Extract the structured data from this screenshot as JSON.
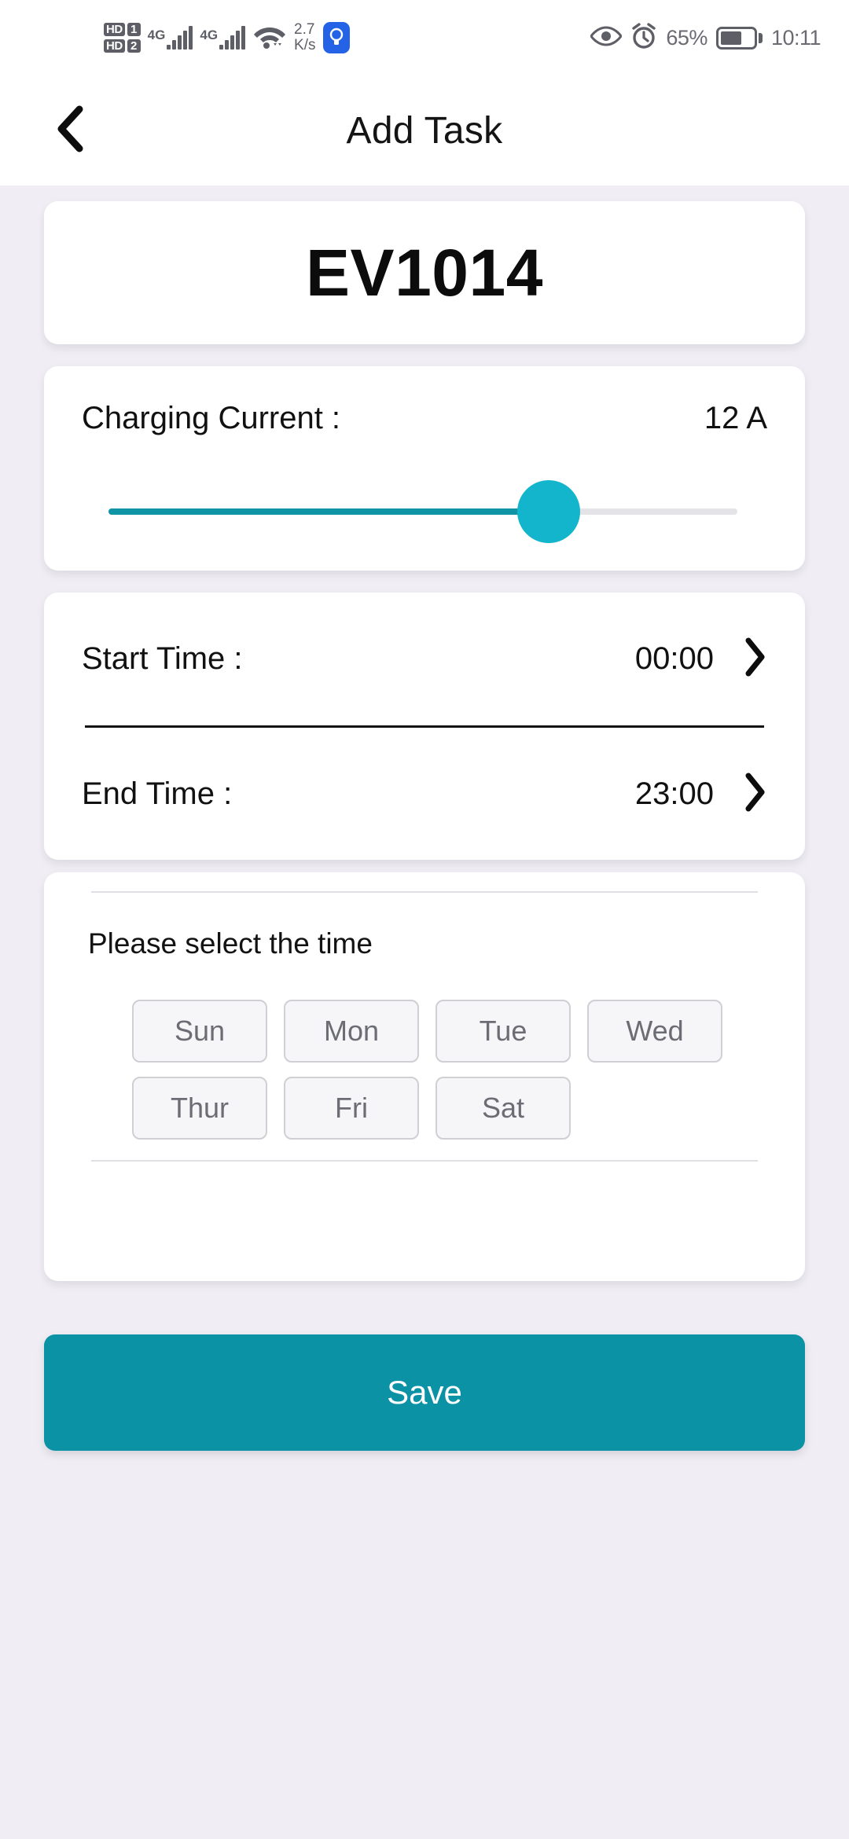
{
  "status_bar": {
    "hd1_label": "HD",
    "sim1_label": "1",
    "hd2_label": "HD",
    "sim2_label": "2",
    "network1": "4G",
    "network2": "4G",
    "data_speed": "2.7",
    "data_speed_unit": "K/s",
    "bulb_icon": "lightbulb-icon",
    "eye_icon": "eye-comfort-icon",
    "alarm_icon": "alarm-clock-icon",
    "battery_percent": "65%",
    "battery_level": 65,
    "time": "10:11"
  },
  "app_bar": {
    "back_icon": "chevron-left-icon",
    "title": "Add Task"
  },
  "device": {
    "name": "EV1014"
  },
  "charging_current": {
    "label": "Charging Current :",
    "value": "12 A",
    "slider_percent": 70,
    "fill_color": "#1095a6",
    "thumb_color": "#13b5cc",
    "track_color": "#e4e3e7"
  },
  "time_settings": {
    "start": {
      "label": "Start Time :",
      "value": "00:00",
      "chevron_icon": "chevron-right-icon"
    },
    "end": {
      "label": "End Time :",
      "value": "23:00",
      "chevron_icon": "chevron-right-icon"
    }
  },
  "days": {
    "hint": "Please select the time",
    "row1": [
      "Sun",
      "Mon",
      "Tue",
      "Wed"
    ],
    "row2": [
      "Thur",
      "Fri",
      "Sat"
    ]
  },
  "actions": {
    "save_label": "Save",
    "save_color": "#0b93a5"
  }
}
